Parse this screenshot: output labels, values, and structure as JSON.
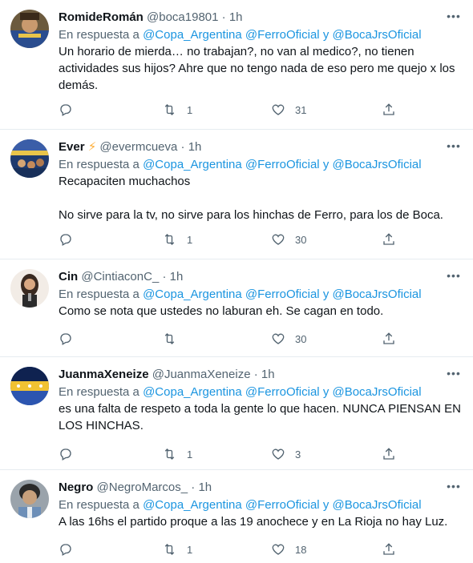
{
  "tweets": [
    {
      "name": "RomideRomán",
      "handle": "@boca19801",
      "dot": "·",
      "time": "1h",
      "reply_prefix": "En respuesta a",
      "mention1": "@Copa_Argentina",
      "mention2": "@FerroOficial",
      "conj": "y",
      "mention3": "@BocaJrsOficial",
      "text": "Un horario de mierda… no trabajan?, no van al medico?, no tienen actividades sus hijos? Ahre que no tengo nada de eso pero me quejo x los demás.",
      "retweets": "1",
      "likes": "31"
    },
    {
      "name": "Ever",
      "emoji": "⚡",
      "handle": "@evermcueva",
      "dot": "·",
      "time": "1h",
      "reply_prefix": "En respuesta a",
      "mention1": "@Copa_Argentina",
      "mention2": "@FerroOficial",
      "conj": "y",
      "mention3": "@BocaJrsOficial",
      "text": "Recapaciten muchachos\n\nNo sirve para la tv, no sirve para los hinchas de Ferro, para los de Boca.",
      "retweets": "1",
      "likes": "30"
    },
    {
      "name": "Cin",
      "handle": "@CintiaconC_",
      "dot": "·",
      "time": "1h",
      "reply_prefix": "En respuesta a",
      "mention1": "@Copa_Argentina",
      "mention2": "@FerroOficial",
      "conj": "y",
      "mention3": "@BocaJrsOficial",
      "text": "Como se nota que ustedes no laburan eh. Se cagan en todo.",
      "retweets": "",
      "likes": "30"
    },
    {
      "name": "JuanmaXeneize",
      "handle": "@JuanmaXeneize",
      "dot": "·",
      "time": "1h",
      "reply_prefix": "En respuesta a",
      "mention1": "@Copa_Argentina",
      "mention2": "@FerroOficial",
      "conj": "y",
      "mention3": "@BocaJrsOficial",
      "text": "es una falta de respeto a toda la gente lo que hacen. NUNCA PIENSAN EN LOS HINCHAS.",
      "retweets": "1",
      "likes": "3"
    },
    {
      "name": "Negro",
      "handle": "@NegroMarcos_",
      "dot": "·",
      "time": "1h",
      "reply_prefix": "En respuesta a",
      "mention1": "@Copa_Argentina",
      "mention2": "@FerroOficial",
      "conj": "y",
      "mention3": "@BocaJrsOficial",
      "text": "A las 16hs el partido proque a las 19 anochece y en La Rioja no hay Luz.",
      "retweets": "1",
      "likes": "18"
    }
  ],
  "colors": {
    "link": "#1b95e0",
    "secondary": "#536471",
    "divider": "#e6ecf0",
    "text": "#0f1419"
  }
}
